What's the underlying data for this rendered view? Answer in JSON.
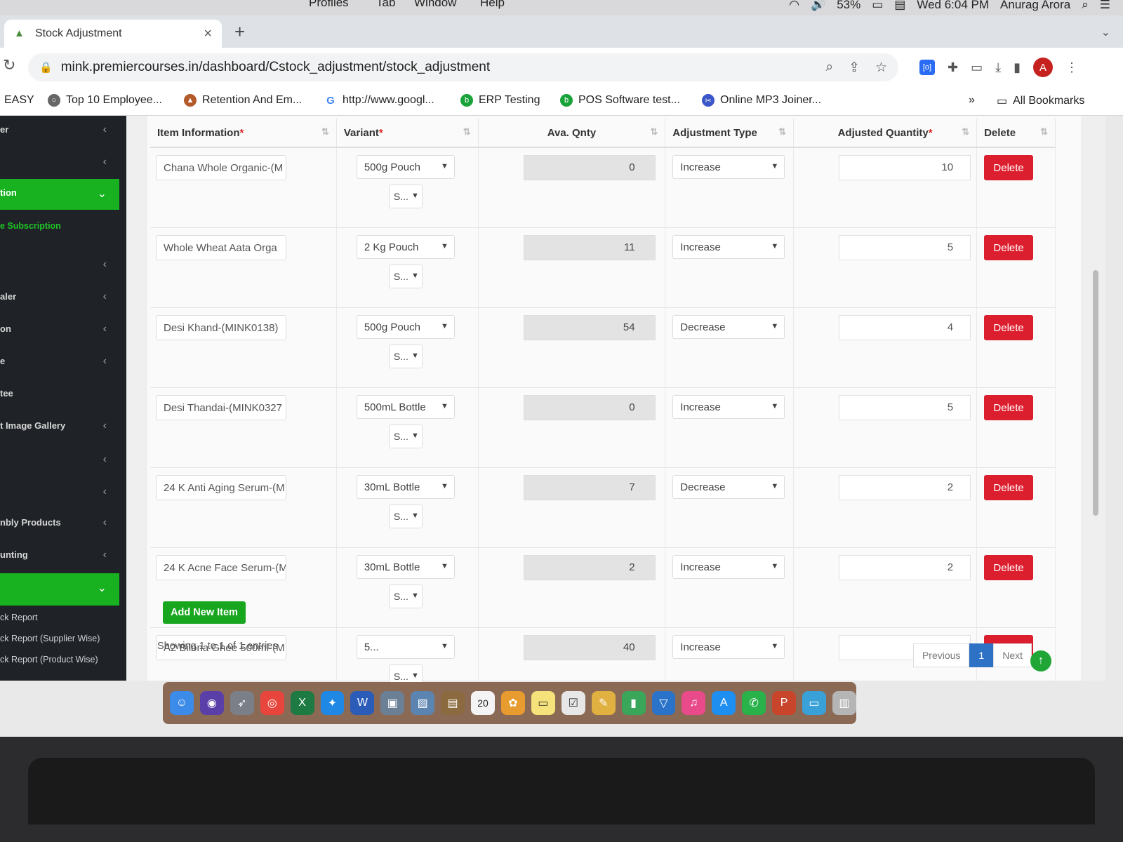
{
  "menubar": {
    "items": [
      "Profiles",
      "Tab",
      "Window",
      "Help"
    ],
    "battery": "53%",
    "clock": "Wed 6:04 PM",
    "user": "Anurag Arora"
  },
  "tab": {
    "title": "Stock Adjustment"
  },
  "address": {
    "url": "mink.premiercourses.in/dashboard/Cstock_adjustment/stock_adjustment"
  },
  "profile": {
    "initial": "A"
  },
  "bookmarks": {
    "items": [
      "EASY",
      "Top 10 Employee...",
      "Retention And Em...",
      "http://www.googl...",
      "ERP Testing",
      "POS Software test...",
      "Online MP3 Joiner..."
    ],
    "more": "»",
    "all": "All Bookmarks"
  },
  "sidebar": {
    "items": [
      "er",
      "",
      "tion",
      "e Subscription",
      "",
      "aler",
      "on",
      "e",
      "tee",
      "t Image Gallery",
      "",
      "",
      "nbly Products",
      "unting",
      "",
      "ck Report",
      "ck Report (Supplier Wise)",
      "ck Report (Product Wise)"
    ]
  },
  "table": {
    "headers": [
      "Item Information",
      "Variant",
      "Ava. Qnty",
      "Adjustment Type",
      "Adjusted Quantity",
      "Delete"
    ],
    "required_mark": "*",
    "rows": [
      {
        "item": "Chana Whole  Organic-(M",
        "variant": "500g Pouch",
        "small": "S...",
        "qty": "0",
        "type": "Increase",
        "adj": "10"
      },
      {
        "item": "Whole Wheat Aata Orga",
        "variant": "2 Kg Pouch",
        "small": "S...",
        "qty": "11",
        "type": "Increase",
        "adj": "5"
      },
      {
        "item": "Desi Khand-(MINK0138)",
        "variant": "500g Pouch",
        "small": "S...",
        "qty": "54",
        "type": "Decrease",
        "adj": "4"
      },
      {
        "item": "Desi Thandai-(MINK0327",
        "variant": "500mL Bottle",
        "small": "S...",
        "qty": "0",
        "type": "Increase",
        "adj": "5"
      },
      {
        "item": "24 K Anti Aging Serum-(M",
        "variant": "30mL Bottle",
        "small": "S...",
        "qty": "7",
        "type": "Decrease",
        "adj": "2"
      },
      {
        "item": "24 K Acne Face Serum-(M",
        "variant": "30mL Bottle",
        "small": "S...",
        "qty": "2",
        "type": "Increase",
        "adj": "2"
      },
      {
        "item": "A2 Bilona Ghee 500ml-(M",
        "variant": "5...",
        "small": "S...",
        "qty": "40",
        "type": "Increase",
        "adj": "5"
      }
    ],
    "delete_label": "Delete"
  },
  "actions": {
    "add_item": "Add New Item"
  },
  "footer": {
    "showing": "Showing 1 to 1 of 1 entries",
    "prev": "Previous",
    "page": "1",
    "next": "Next"
  },
  "dock": {
    "calendar_day": "20"
  },
  "colors": {
    "accent_green": "#18b221",
    "danger_red": "#dc1f2f",
    "page_blue": "#2d72c4"
  }
}
